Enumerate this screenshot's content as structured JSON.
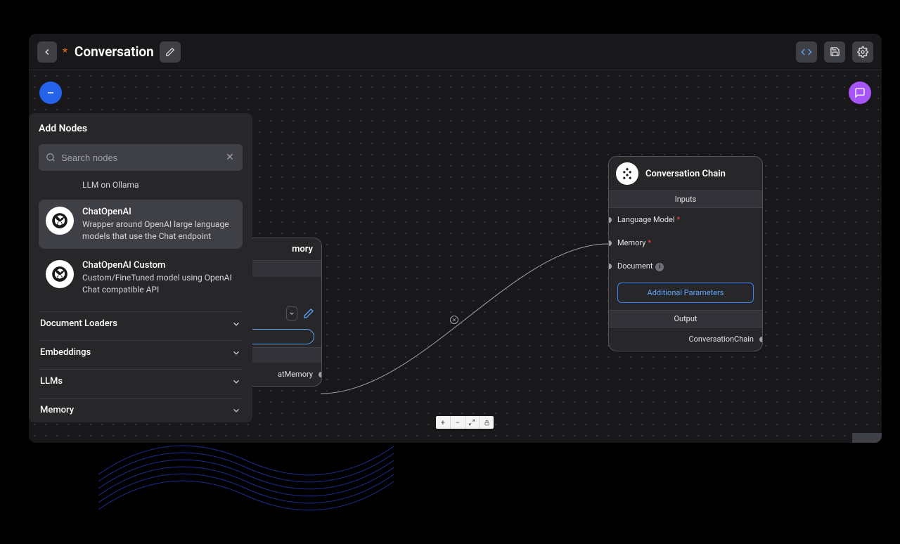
{
  "header": {
    "unsaved_marker": "*",
    "title": "Conversation"
  },
  "sidebar": {
    "title": "Add Nodes",
    "search_placeholder": "Search nodes",
    "items": [
      {
        "title": "",
        "desc": "LLM on Ollama"
      },
      {
        "title": "ChatOpenAI",
        "desc": "Wrapper around OpenAI large language models that use the Chat endpoint"
      },
      {
        "title": "ChatOpenAI Custom",
        "desc": "Custom/FineTuned model using OpenAI Chat compatible API"
      }
    ],
    "categories": [
      "Document Loaders",
      "Embeddings",
      "LLMs",
      "Memory"
    ]
  },
  "chain_node": {
    "title": "Conversation Chain",
    "inputs_label": "Inputs",
    "ports": {
      "language_model": "Language Model",
      "memory": "Memory",
      "document": "Document"
    },
    "additional_btn": "Additional Parameters",
    "output_label": "Output",
    "output_port": "ConversationChain"
  },
  "memory_node": {
    "title": "mory",
    "output_port": "atMemory"
  }
}
